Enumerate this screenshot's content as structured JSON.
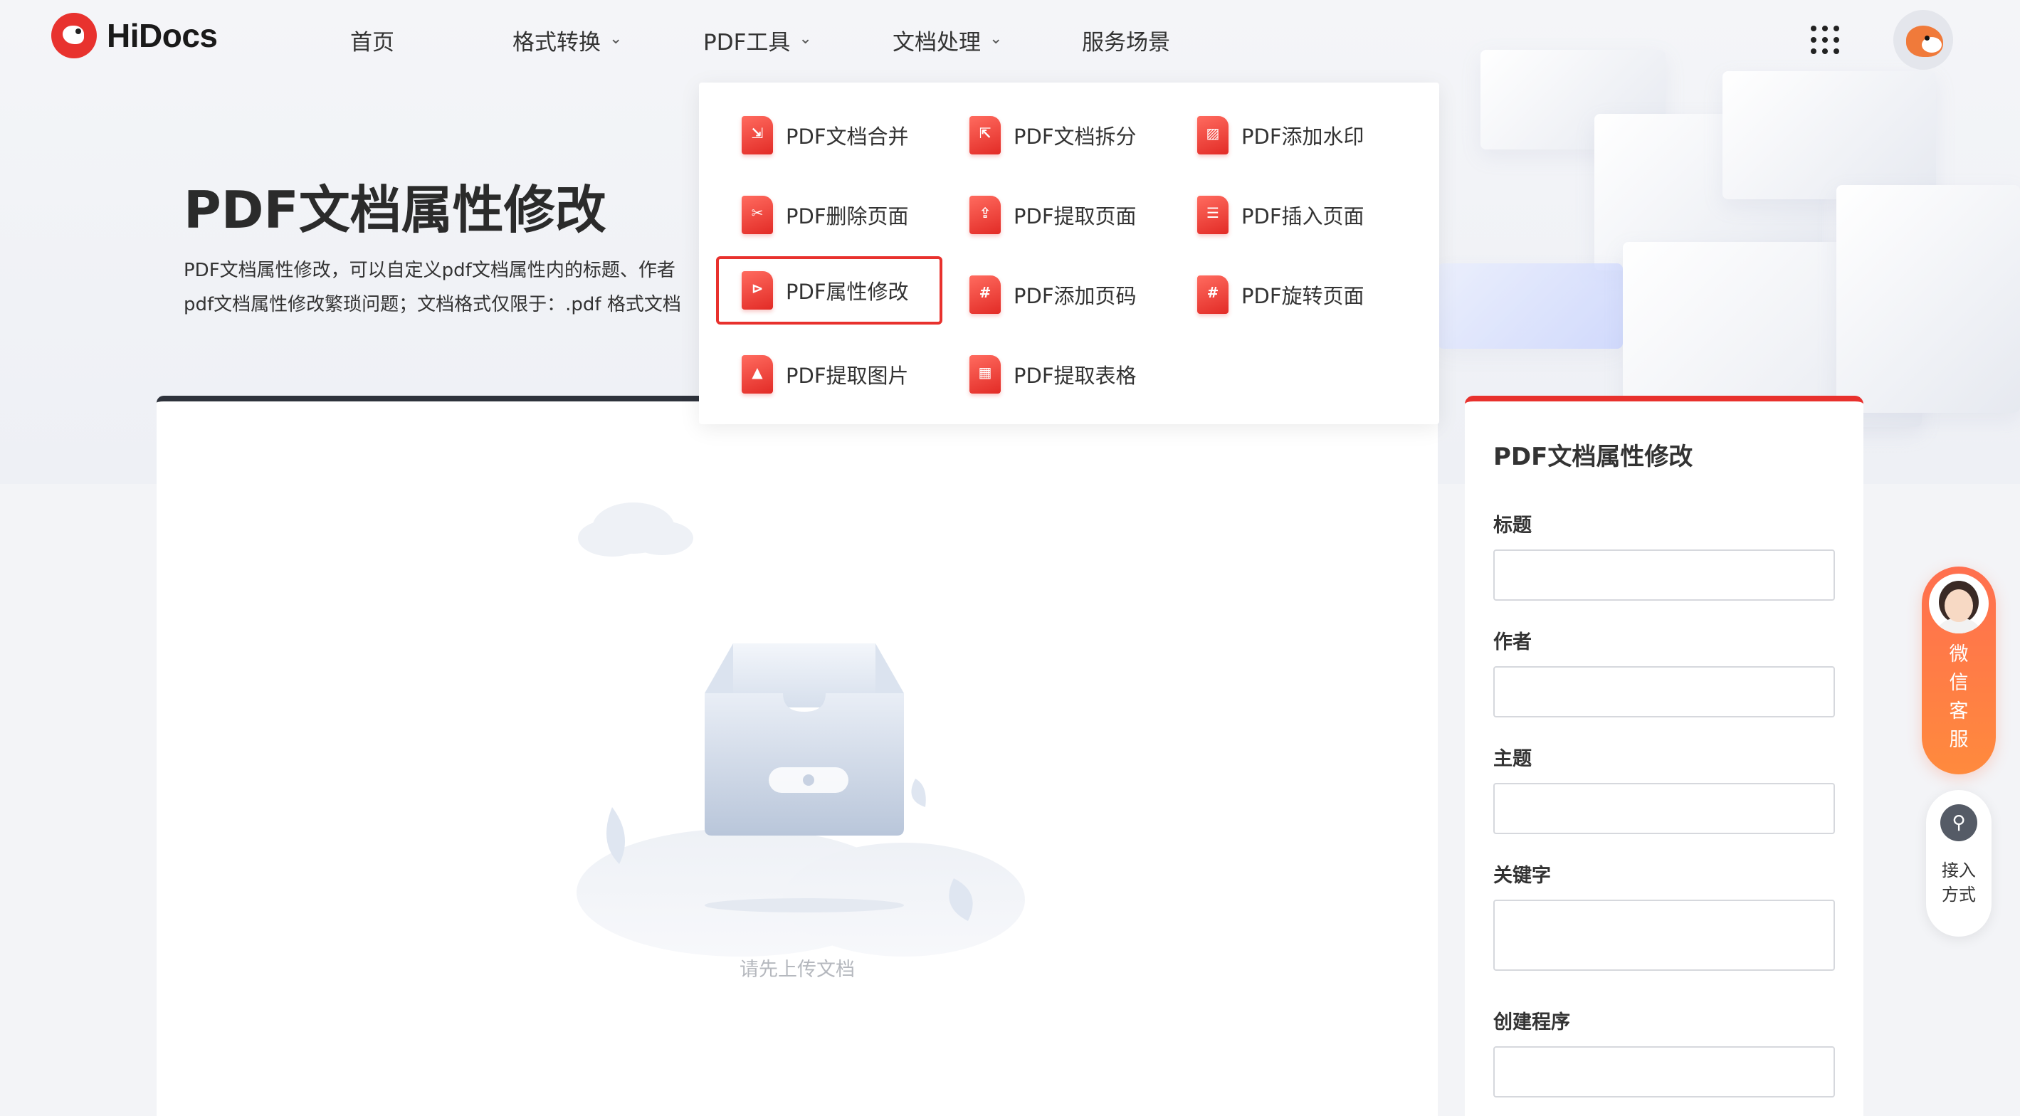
{
  "brand": {
    "name": "HiDocs"
  },
  "nav": {
    "items": [
      {
        "label": "首页",
        "has_dropdown": false
      },
      {
        "label": "格式转换",
        "has_dropdown": true
      },
      {
        "label": "PDF工具",
        "has_dropdown": true
      },
      {
        "label": "文档处理",
        "has_dropdown": true
      },
      {
        "label": "服务场景",
        "has_dropdown": false
      }
    ],
    "chevron": "⌄"
  },
  "hero": {
    "title": "PDF文档属性修改",
    "desc_line1": "PDF文档属性修改，可以自定义pdf文档属性内的标题、作者",
    "desc_line2": "pdf文档属性修改繁琐问题；文档格式仅限于：.pdf 格式文档"
  },
  "dropdown": {
    "items": [
      {
        "label": "PDF文档合并",
        "icon": "merge-icon",
        "sym": "⇲"
      },
      {
        "label": "PDF文档拆分",
        "icon": "split-icon",
        "sym": "⇱"
      },
      {
        "label": "PDF添加水印",
        "icon": "watermark-icon",
        "sym": "▨"
      },
      {
        "label": "PDF删除页面",
        "icon": "delete-page-icon",
        "sym": "✂"
      },
      {
        "label": "PDF提取页面",
        "icon": "extract-page-icon",
        "sym": "⇪"
      },
      {
        "label": "PDF插入页面",
        "icon": "insert-page-icon",
        "sym": "☰"
      },
      {
        "label": "PDF属性修改",
        "icon": "properties-icon",
        "sym": "⊳",
        "active": true
      },
      {
        "label": "PDF添加页码",
        "icon": "page-number-icon",
        "sym": "#"
      },
      {
        "label": "PDF旋转页面",
        "icon": "rotate-page-icon",
        "sym": "#"
      },
      {
        "label": "PDF提取图片",
        "icon": "extract-image-icon",
        "sym": "▲"
      },
      {
        "label": "PDF提取表格",
        "icon": "extract-table-icon",
        "sym": "▦"
      }
    ]
  },
  "upload": {
    "empty_text": "请先上传文档"
  },
  "form": {
    "title": "PDF文档属性修改",
    "fields": [
      {
        "label": "标题",
        "value": ""
      },
      {
        "label": "作者",
        "value": ""
      },
      {
        "label": "主题",
        "value": ""
      },
      {
        "label": "关键字",
        "value": ""
      },
      {
        "label": "创建程序",
        "value": ""
      }
    ]
  },
  "floating": {
    "service_label_1": "微",
    "service_label_2": "信",
    "service_label_3": "客",
    "service_label_4": "服",
    "contact_label_1": "接入",
    "contact_label_2": "方式"
  },
  "colors": {
    "accent": "#e8312d",
    "dark_bar": "#2e323b",
    "service": "#ff7a45"
  }
}
